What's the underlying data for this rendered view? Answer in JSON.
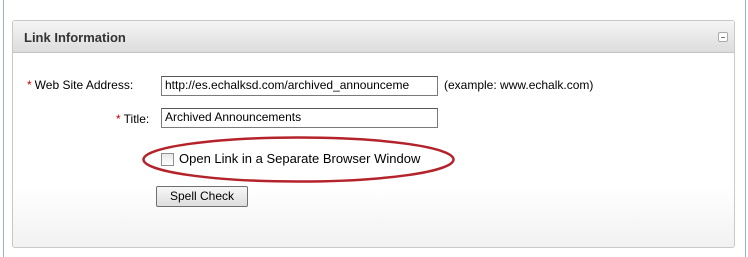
{
  "panel": {
    "title": "Link Information"
  },
  "form": {
    "web_address": {
      "required_mark": "*",
      "label": "Web Site Address:",
      "value": "http://es.echalksd.com/archived_announceme",
      "hint": "(example: www.echalk.com)"
    },
    "title_field": {
      "required_mark": "*",
      "label": "Title:",
      "value": "Archived Announcements"
    },
    "separate_window": {
      "label": "Open Link in a Separate Browser Window",
      "checked": false
    },
    "spell_check_label": "Spell Check"
  },
  "colors": {
    "required": "#cc0000",
    "highlight_ellipse": "#b4232a",
    "frame_border": "#9fb1c9"
  },
  "icons": {
    "collapse": "collapse-minus-icon"
  }
}
